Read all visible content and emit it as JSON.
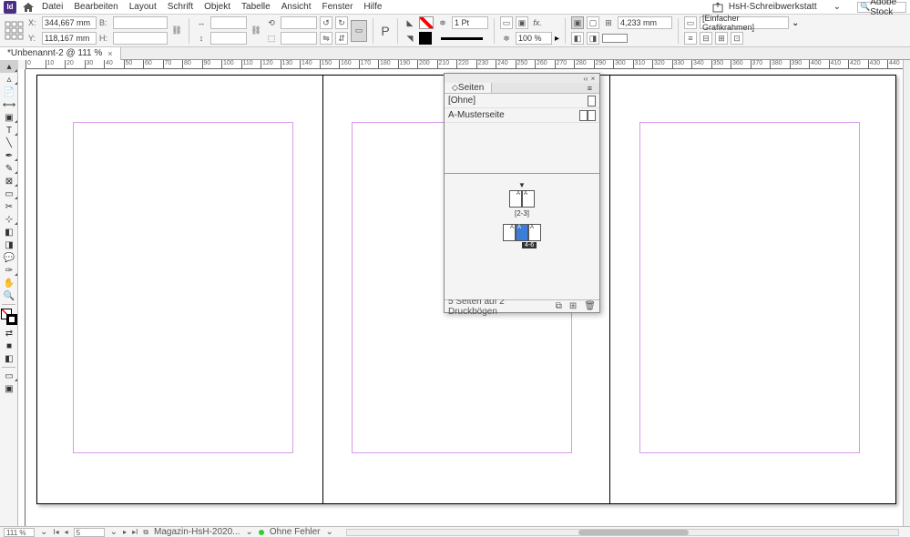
{
  "menu": {
    "items": [
      "Datei",
      "Bearbeiten",
      "Layout",
      "Schrift",
      "Objekt",
      "Tabelle",
      "Ansicht",
      "Fenster",
      "Hilfe"
    ],
    "workspace": "HsH-Schreibwerkstatt",
    "search": "Adobe Stock"
  },
  "control": {
    "x": "344,667 mm",
    "y": "118,167 mm",
    "w": "",
    "h": "",
    "stroke_weight": "1 Pt",
    "zoom": "100 %",
    "wh_dropdown": "4,233 mm",
    "frame_style": "[Einfacher Grafikrahmen]"
  },
  "tab": {
    "title": "*Unbenannt-2 @ 111 %",
    "close": "×"
  },
  "ruler": {
    "start": 0,
    "step": 10,
    "count": 45
  },
  "panel": {
    "title": "Seiten",
    "masters": [
      {
        "name": "[Ohne]",
        "pages": 1
      },
      {
        "name": "A-Musterseite",
        "pages": 2
      }
    ],
    "spread1_label": "[2-3]",
    "spread2_label": "4-6",
    "footer": "5 Seiten auf 2 Druckbögen"
  },
  "status": {
    "zoom": "111 %",
    "page": "5",
    "file": "Magazin-HsH-2020...",
    "preflight": "Ohne Fehler"
  }
}
